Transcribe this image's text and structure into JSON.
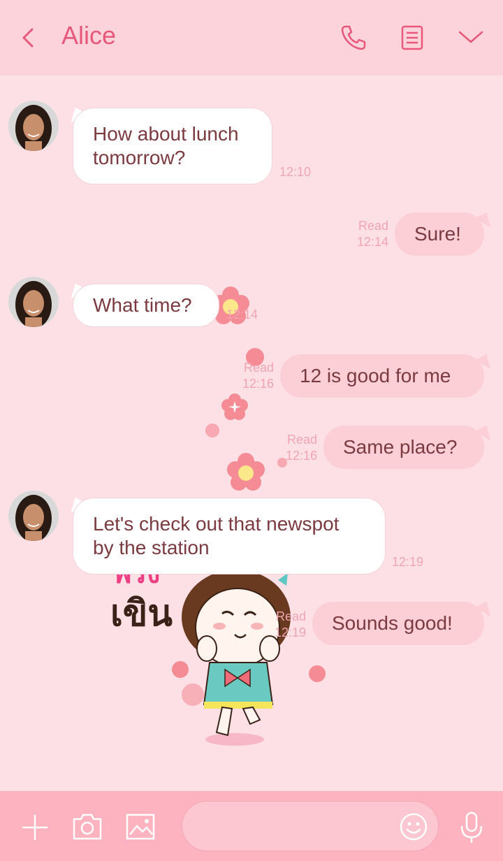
{
  "header": {
    "title": "Alice",
    "back_icon": "chevron-left-icon",
    "call_icon": "phone-icon",
    "notes_icon": "notes-icon",
    "menu_icon": "chevron-down-icon"
  },
  "messages": [
    {
      "side": "in",
      "lines": [
        "How about lunch",
        "tomorrow?"
      ],
      "time": "12:10"
    },
    {
      "side": "out",
      "text": "Sure!",
      "read": "Read",
      "time": "12:14"
    },
    {
      "side": "in",
      "text": "What time?",
      "time": "12:14"
    },
    {
      "side": "out",
      "text": "12 is good for me",
      "read": "Read",
      "time": "12:16"
    },
    {
      "side": "out",
      "text": "Same place?",
      "read": "Read",
      "time": "12:16"
    },
    {
      "side": "in",
      "lines": [
        "Let's check out that newspot",
        "by the station"
      ],
      "time": "12:19"
    },
    {
      "side": "out",
      "text": "Sounds good!",
      "read": "Read",
      "time": "12:19"
    }
  ],
  "sticker": {
    "line1": "พรง",
    "line2": "เขิน"
  },
  "footer": {
    "add_icon": "plus-icon",
    "camera_icon": "camera-icon",
    "image_icon": "image-icon",
    "emoji_icon": "smiley-icon",
    "mic_icon": "microphone-icon"
  },
  "colors": {
    "header_bg": "#fdd3db",
    "chat_bg": "#fde0e6",
    "accent": "#e8587a",
    "outgoing_bubble": "#fccfd7",
    "footer_bg": "#fdb4c0"
  }
}
